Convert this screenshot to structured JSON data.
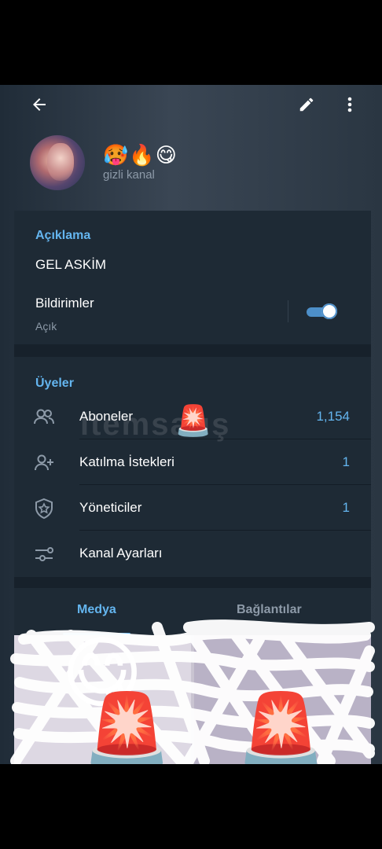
{
  "header": {
    "title": "🥵🔥😋",
    "subtitle": "gizli kanal"
  },
  "info": {
    "description_label": "Açıklama",
    "description_text": "GEL ASKİM",
    "notifications_label": "Bildirimler",
    "notifications_state": "Açık",
    "notifications_on": true
  },
  "members": {
    "section_label": "Üyeler",
    "items": [
      {
        "label": "Aboneler",
        "value": "1,154",
        "icon": "people-icon"
      },
      {
        "label": "Katılma İstekleri",
        "value": "1",
        "icon": "add-user-icon"
      },
      {
        "label": "Yöneticiler",
        "value": "1",
        "icon": "shield-star-icon"
      },
      {
        "label": "Kanal Ayarları",
        "value": "",
        "icon": "sliders-icon"
      }
    ]
  },
  "tabs": [
    {
      "label": "Medya",
      "active": true
    },
    {
      "label": "Bağlantılar",
      "active": false
    }
  ],
  "overlay": {
    "watermark": "itemsatış",
    "siren": "🚨",
    "smile": "😋"
  },
  "colors": {
    "accent": "#64b5ef",
    "panel": "#1e2a35",
    "background": "#17212b"
  }
}
